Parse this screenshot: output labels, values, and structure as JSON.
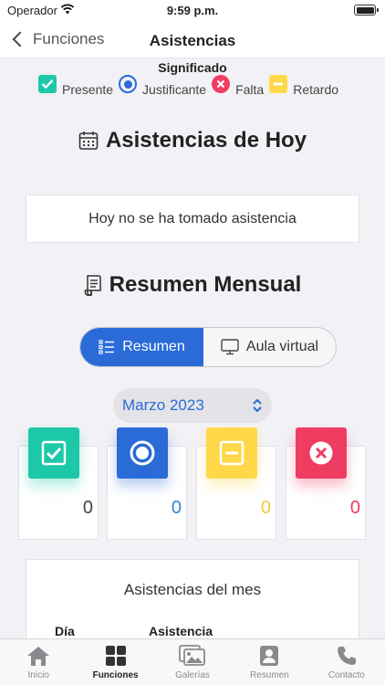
{
  "status": {
    "carrier": "Operador",
    "time": "9:59 p.m."
  },
  "nav": {
    "back_label": "Funciones",
    "title": "Asistencias"
  },
  "legend": {
    "title": "Significado",
    "items": [
      {
        "label": "Presente",
        "icon": "check-square-icon",
        "color": "#1dc8a9"
      },
      {
        "label": "Justificante",
        "icon": "radio-dot-icon",
        "color": "#2a6bd8"
      },
      {
        "label": "Falta",
        "icon": "x-circle-icon",
        "color": "#ef3d61"
      },
      {
        "label": "Retardo",
        "icon": "minus-square-icon",
        "color": "#ffd84a"
      }
    ]
  },
  "today": {
    "heading": "Asistencias de Hoy",
    "message": "Hoy no se ha tomado asistencia"
  },
  "summary": {
    "heading": "Resumen Mensual",
    "segments": [
      "Resumen",
      "Aula virtual"
    ],
    "month": "Marzo 2023",
    "stats": [
      {
        "letter": "A",
        "count": "0",
        "color": "#1dc8a9"
      },
      {
        "letter": "J",
        "count": "0",
        "color": "#2a6bd8"
      },
      {
        "letter": "R",
        "count": "0",
        "color": "#ffd84a"
      },
      {
        "letter": "F",
        "count": "0",
        "color": "#ef3d61"
      }
    ],
    "month_card": {
      "title": "Asistencias del mes",
      "col_day": "Día",
      "col_attendance": "Asistencia"
    }
  },
  "tabs": [
    {
      "label": "Inicio",
      "icon": "home-icon"
    },
    {
      "label": "Funciones",
      "icon": "grid-icon",
      "active": true
    },
    {
      "label": "Galerías",
      "icon": "gallery-icon"
    },
    {
      "label": "Resumen",
      "icon": "person-card-icon"
    },
    {
      "label": "Contacto",
      "icon": "phone-icon"
    }
  ],
  "colors": {
    "accent": "#2a6bd8",
    "present": "#1dc8a9",
    "absent": "#ef3d61",
    "late": "#ffd84a"
  }
}
